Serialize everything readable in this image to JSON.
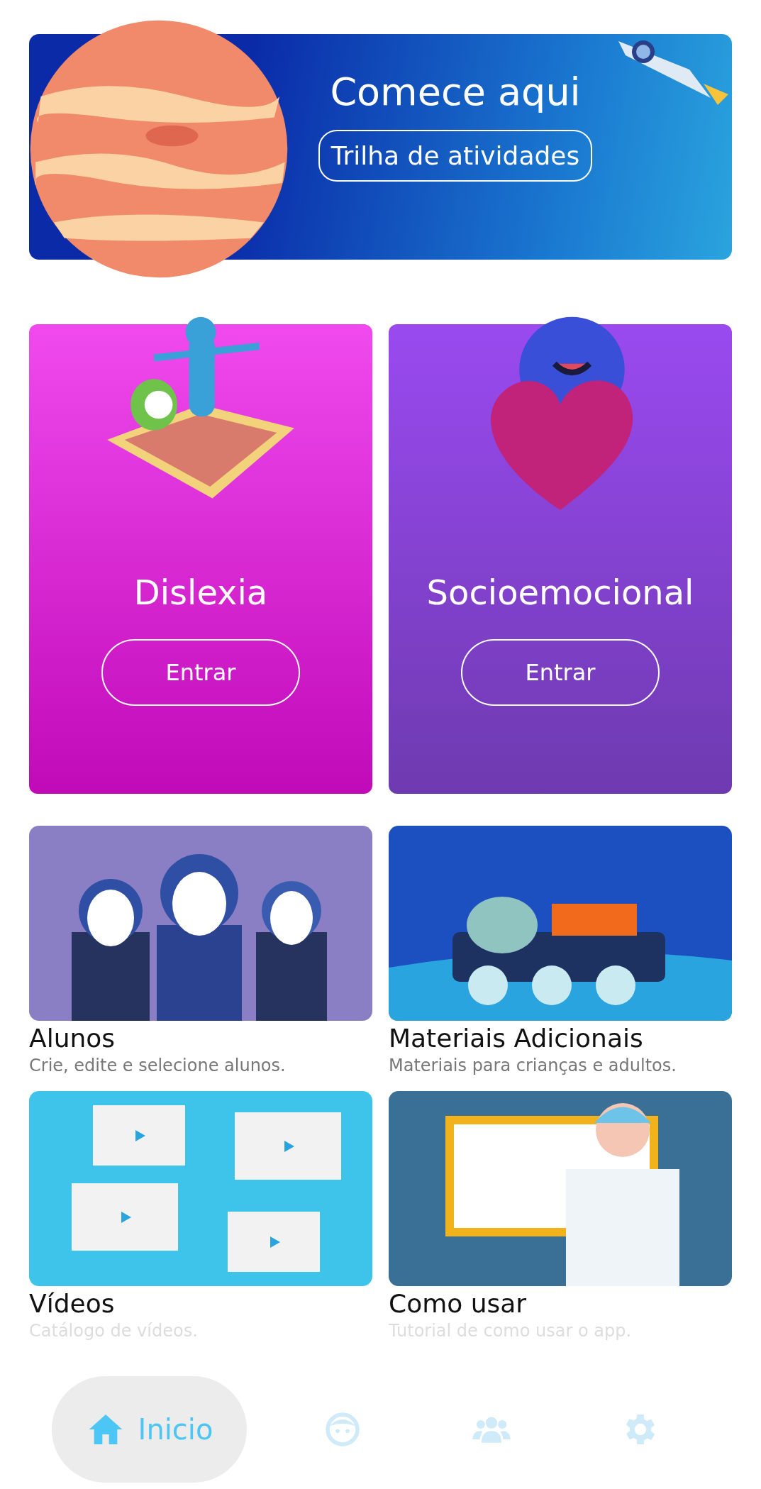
{
  "banner": {
    "title": "Comece aqui",
    "button": "Trilha de atividades"
  },
  "programs": [
    {
      "title": "Dislexia",
      "button": "Entrar",
      "kind": "book"
    },
    {
      "title": "Socioemocional",
      "button": "Entrar",
      "kind": "heart"
    }
  ],
  "tiles": [
    {
      "title": "Alunos",
      "subtitle": "Crie, edite e selecione alunos.",
      "kind": "students"
    },
    {
      "title": "Materiais Adicionais",
      "subtitle": "Materiais para crianças e adultos.",
      "kind": "rover"
    },
    {
      "title": "Vídeos",
      "subtitle": "Catálogo de vídeos.",
      "kind": "videos"
    },
    {
      "title": "Como usar",
      "subtitle": "Tutorial de como usar o app.",
      "kind": "teacher"
    }
  ],
  "nav": [
    {
      "kind": "home",
      "label": "Inicio",
      "selected": true
    },
    {
      "kind": "child",
      "selected": false
    },
    {
      "kind": "group",
      "selected": false
    },
    {
      "kind": "settings",
      "selected": false
    }
  ]
}
